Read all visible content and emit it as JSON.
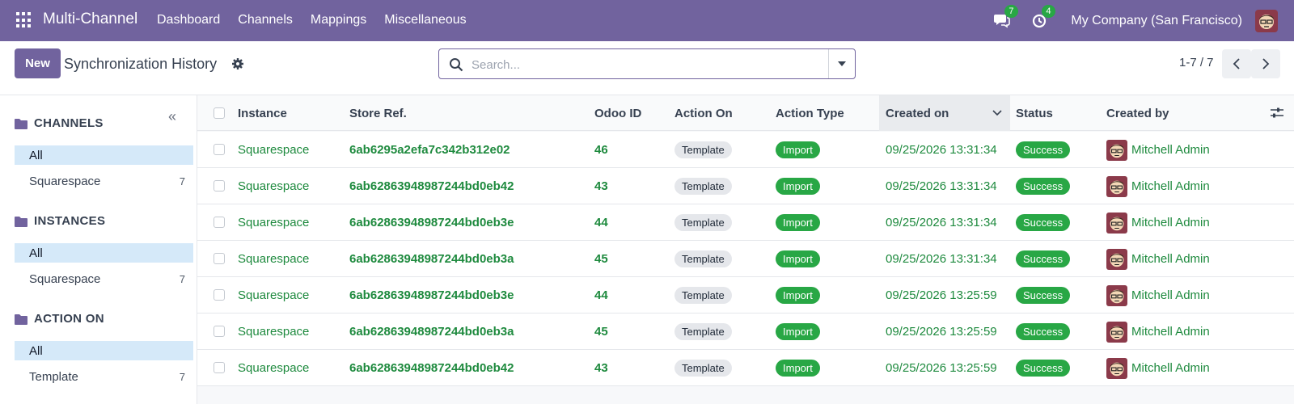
{
  "navbar": {
    "brand": "Multi-Channel",
    "menu": [
      "Dashboard",
      "Channels",
      "Mappings",
      "Miscellaneous"
    ],
    "messages_count": "7",
    "activities_count": "4",
    "company": "My Company (San Francisco)"
  },
  "control": {
    "new_label": "New",
    "title": "Synchronization History",
    "search_placeholder": "Search...",
    "pager": "1-7 / 7"
  },
  "sidebar": {
    "sections": [
      {
        "title": "CHANNELS",
        "items": [
          {
            "label": "All",
            "count": ""
          },
          {
            "label": "Squarespace",
            "count": "7"
          }
        ]
      },
      {
        "title": "INSTANCES",
        "items": [
          {
            "label": "All",
            "count": ""
          },
          {
            "label": "Squarespace",
            "count": "7"
          }
        ]
      },
      {
        "title": "ACTION ON",
        "items": [
          {
            "label": "All",
            "count": ""
          },
          {
            "label": "Template",
            "count": "7"
          }
        ]
      }
    ]
  },
  "table": {
    "columns": [
      "Instance",
      "Store Ref.",
      "Odoo ID",
      "Action On",
      "Action Type",
      "Created on",
      "Status",
      "Created by"
    ],
    "rows": [
      {
        "instance": "Squarespace",
        "store_ref": "6ab6295a2efa7c342b312e02",
        "odoo_id": "46",
        "action_on": "Template",
        "action_type": "Import",
        "created_on": "09/25/2026 13:31:34",
        "status": "Success",
        "created_by": "Mitchell Admin"
      },
      {
        "instance": "Squarespace",
        "store_ref": "6ab62863948987244bd0eb42",
        "odoo_id": "43",
        "action_on": "Template",
        "action_type": "Import",
        "created_on": "09/25/2026 13:31:34",
        "status": "Success",
        "created_by": "Mitchell Admin"
      },
      {
        "instance": "Squarespace",
        "store_ref": "6ab62863948987244bd0eb3e",
        "odoo_id": "44",
        "action_on": "Template",
        "action_type": "Import",
        "created_on": "09/25/2026 13:31:34",
        "status": "Success",
        "created_by": "Mitchell Admin"
      },
      {
        "instance": "Squarespace",
        "store_ref": "6ab62863948987244bd0eb3a",
        "odoo_id": "45",
        "action_on": "Template",
        "action_type": "Import",
        "created_on": "09/25/2026 13:31:34",
        "status": "Success",
        "created_by": "Mitchell Admin"
      },
      {
        "instance": "Squarespace",
        "store_ref": "6ab62863948987244bd0eb3e",
        "odoo_id": "44",
        "action_on": "Template",
        "action_type": "Import",
        "created_on": "09/25/2026 13:25:59",
        "status": "Success",
        "created_by": "Mitchell Admin"
      },
      {
        "instance": "Squarespace",
        "store_ref": "6ab62863948987244bd0eb3a",
        "odoo_id": "45",
        "action_on": "Template",
        "action_type": "Import",
        "created_on": "09/25/2026 13:25:59",
        "status": "Success",
        "created_by": "Mitchell Admin"
      },
      {
        "instance": "Squarespace",
        "store_ref": "6ab62863948987244bd0eb42",
        "odoo_id": "43",
        "action_on": "Template",
        "action_type": "Import",
        "created_on": "09/25/2026 13:25:59",
        "status": "Success",
        "created_by": "Mitchell Admin"
      }
    ]
  },
  "colors": {
    "brand": "#71639e",
    "success": "#28a745",
    "link": "#1e8a3e",
    "active_filter": "#d5e9f9"
  },
  "icons": [
    "apps-icon",
    "chat-icon",
    "activity-icon",
    "gear-icon",
    "search-icon",
    "caret-down-icon",
    "chevron-left-icon",
    "chevron-right-icon",
    "collapse-icon",
    "folder-icon",
    "sort-down-icon",
    "settings-sliders-icon"
  ]
}
